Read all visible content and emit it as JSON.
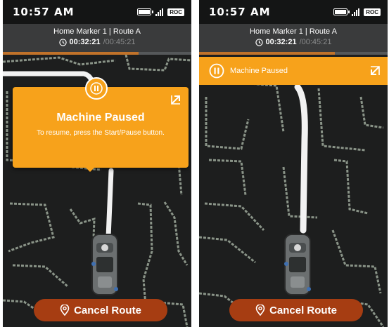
{
  "left_screen": {
    "status_bar": {
      "time": "10:57 AM",
      "network_badge": "ROC"
    },
    "header": {
      "title": "Home Marker 1 | Route A",
      "elapsed": "00:32:21",
      "total": "/00:45:21"
    },
    "progress_fraction": 0.72,
    "popup": {
      "title": "Machine Paused",
      "message": "To resume, press the Start/Pause button.",
      "expand_icon": "expand-arrow-icon"
    },
    "cancel_button": {
      "label": "Cancel Route",
      "icon": "location-pin-icon"
    }
  },
  "right_screen": {
    "status_bar": {
      "time": "10:57 AM",
      "network_badge": "ROC"
    },
    "header": {
      "title": "Home Marker 1 | Route A",
      "elapsed": "00:32:21",
      "total": "/00:45:21"
    },
    "progress_fraction": 0.72,
    "banner": {
      "label": "Machine Paused",
      "icon": "pause-icon",
      "expand_icon": "expand-arrow-icon"
    },
    "cancel_button": {
      "label": "Cancel Route",
      "icon": "location-pin-icon"
    }
  },
  "colors": {
    "accent": "#f7a21b",
    "cancel": "#a63d12",
    "header": "#3a3b3c",
    "status_bar": "#141515",
    "map_bg": "#1d1e1e",
    "map_walls": "#8a9488",
    "path": "#f2f2f2"
  }
}
